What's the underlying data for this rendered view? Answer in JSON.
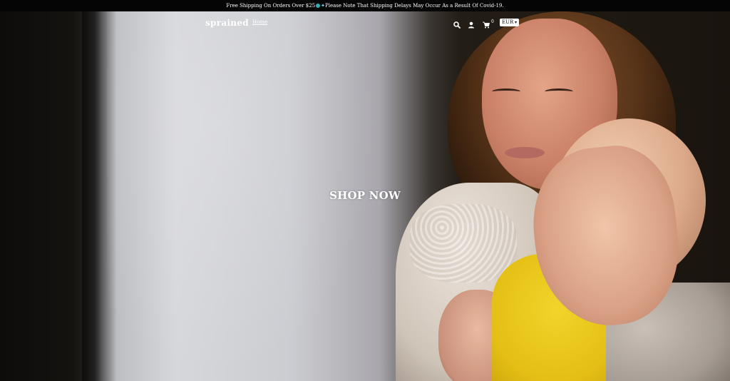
{
  "announcement": {
    "text_before": "Free Shipping On Orders Over $25",
    "text_after": "Please Note That Shipping Delays May Occur As a Result Of Covid-19."
  },
  "header": {
    "logo": "sprained",
    "nav": {
      "home": "Home"
    },
    "icons": [
      "search-icon",
      "account-icon",
      "cart-icon"
    ],
    "cart_count": "0",
    "currency": "EUR"
  },
  "hero": {
    "cta_label": "SHOP NOW"
  },
  "colors": {
    "announcement_bg": "#050505",
    "text": "#ffffff",
    "emoji_teal": "#2bb1b9",
    "emoji_blue": "#3a7bd5"
  }
}
